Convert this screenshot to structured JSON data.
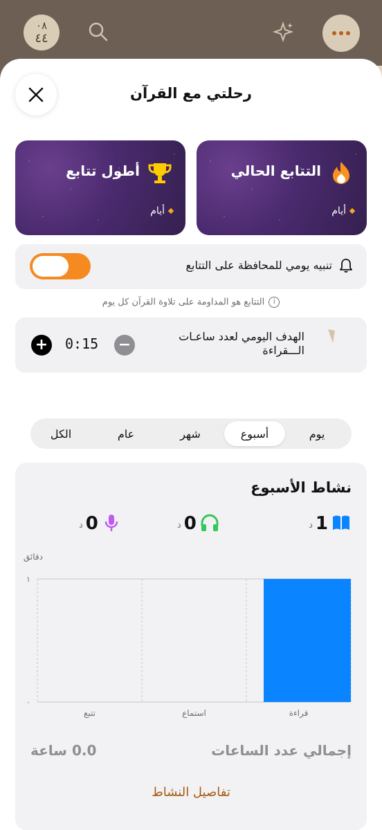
{
  "top": {
    "badge_line1": "٠٨",
    "badge_line2": "٤٤"
  },
  "sheet": {
    "title": "رحلتي مع القرآن"
  },
  "streak": {
    "current_title": "التتابع الحالي",
    "current_days_label": "أيام",
    "longest_title": "أطول تتابع",
    "longest_days_label": "أيام"
  },
  "alert": {
    "label": "تنبيه يومي للمحافظة على التتابع",
    "enabled": true
  },
  "info": {
    "text": "التتابع هو المداومة على تلاوة القرآن كل يوم"
  },
  "goal": {
    "label": "الهدف اليومي لعدد ساعـات الـــقراءة",
    "time": "0:15"
  },
  "tabs": [
    {
      "label": "يوم",
      "active": false
    },
    {
      "label": "أسبوع",
      "active": true
    },
    {
      "label": "شهر",
      "active": false
    },
    {
      "label": "عام",
      "active": false
    },
    {
      "label": "الكل",
      "active": false
    }
  ],
  "activity": {
    "title": "نشاط الأسبوع",
    "stats": {
      "reading_value": "1",
      "reading_unit": "د",
      "listening_value": "0",
      "listening_unit": "د",
      "recitation_value": "0",
      "recitation_unit": "د"
    },
    "total_label": "إجمالي عدد الساعات",
    "total_value": "0.0 ساعة",
    "details_link": "تفاصيل النشاط"
  },
  "colors": {
    "accent_orange": "#f58a21",
    "bar_blue": "#0a84ff",
    "listen_green": "#34c759",
    "mic_purple": "#bf5af2",
    "link_brown": "#a35b12"
  },
  "chart_data": {
    "type": "bar",
    "ylabel": "دقائق",
    "categories": [
      "قراءة",
      "استماع",
      "تتبع"
    ],
    "values": [
      1,
      0,
      0
    ],
    "ylim": [
      0,
      1
    ],
    "yticks": [
      "١",
      "٠"
    ],
    "grid": true
  }
}
